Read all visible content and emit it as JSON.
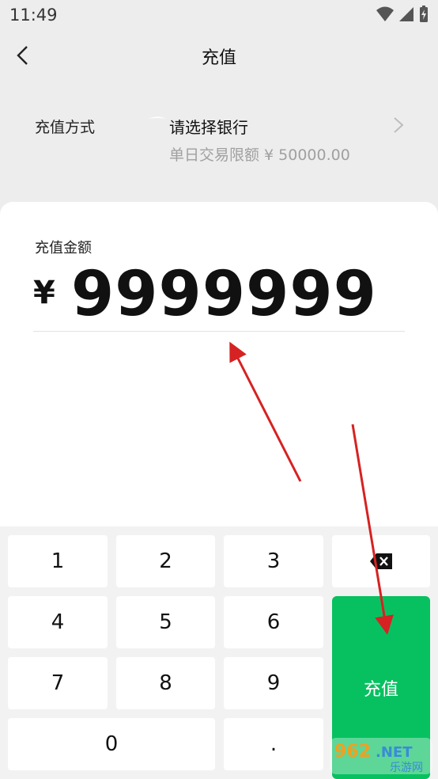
{
  "status": {
    "time": "11:49"
  },
  "nav": {
    "title": "充值"
  },
  "method": {
    "label": "充值方式",
    "bank_placeholder": "请选择银行",
    "limit": "单日交易限额 ¥ 50000.00"
  },
  "amount": {
    "label": "充值金额",
    "currency": "¥",
    "value": "9999999"
  },
  "keypad": {
    "k1": "1",
    "k2": "2",
    "k3": "3",
    "k4": "4",
    "k5": "5",
    "k6": "6",
    "k7": "7",
    "k8": "8",
    "k9": "9",
    "k0": "0",
    "kdot": ".",
    "submit": "充值"
  },
  "colors": {
    "accent": "#07c160",
    "arrow": "#d62222"
  },
  "watermark": {
    "text": "962.NET",
    "subtext": "乐游网"
  }
}
